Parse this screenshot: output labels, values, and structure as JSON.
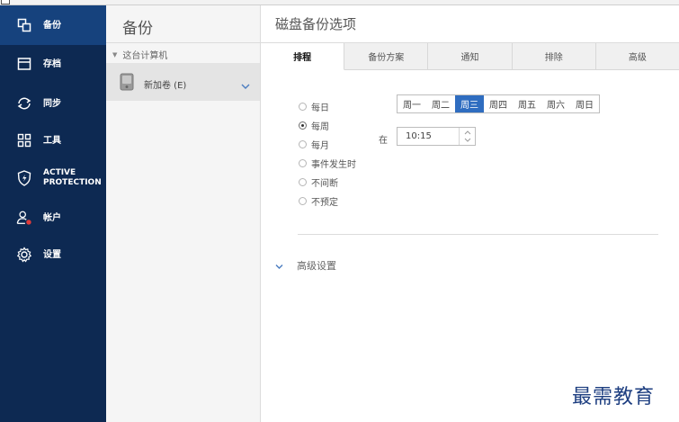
{
  "nav": {
    "items": [
      {
        "label": "备份",
        "icon": "backup-copy-icon"
      },
      {
        "label": "存档",
        "icon": "archive-icon"
      },
      {
        "label": "同步",
        "icon": "sync-icon"
      },
      {
        "label": "工具",
        "icon": "tools-grid-icon"
      },
      {
        "label": "ACTIVE\nPROTECTION",
        "icon": "shield-icon"
      },
      {
        "label": "帐户",
        "icon": "account-icon"
      },
      {
        "label": "设置",
        "icon": "gear-icon"
      }
    ],
    "active_index": 0
  },
  "backup_list": {
    "title": "备份",
    "group_label": "这台计算机",
    "item": {
      "name": "新加卷 (E)",
      "icon": "hard-drive-icon"
    }
  },
  "main": {
    "title": "磁盘备份选项",
    "tabs": [
      "排程",
      "备份方案",
      "通知",
      "排除",
      "高级"
    ],
    "active_tab_index": 0,
    "schedule": {
      "options": [
        "每日",
        "每周",
        "每月",
        "事件发生时",
        "不间断",
        "不预定"
      ],
      "selected_index": 1,
      "days": [
        "周一",
        "周二",
        "周三",
        "周四",
        "周五",
        "周六",
        "周日"
      ],
      "selected_day_index": 2,
      "at_label": "在",
      "time": "10:15"
    },
    "advanced_settings_label": "高级设置"
  },
  "watermark": "最需教育",
  "colors": {
    "nav_bg": "#0d2952",
    "nav_active_bg": "#16427d",
    "accent": "#2f6dc0",
    "watermark": "#1d3e80"
  }
}
